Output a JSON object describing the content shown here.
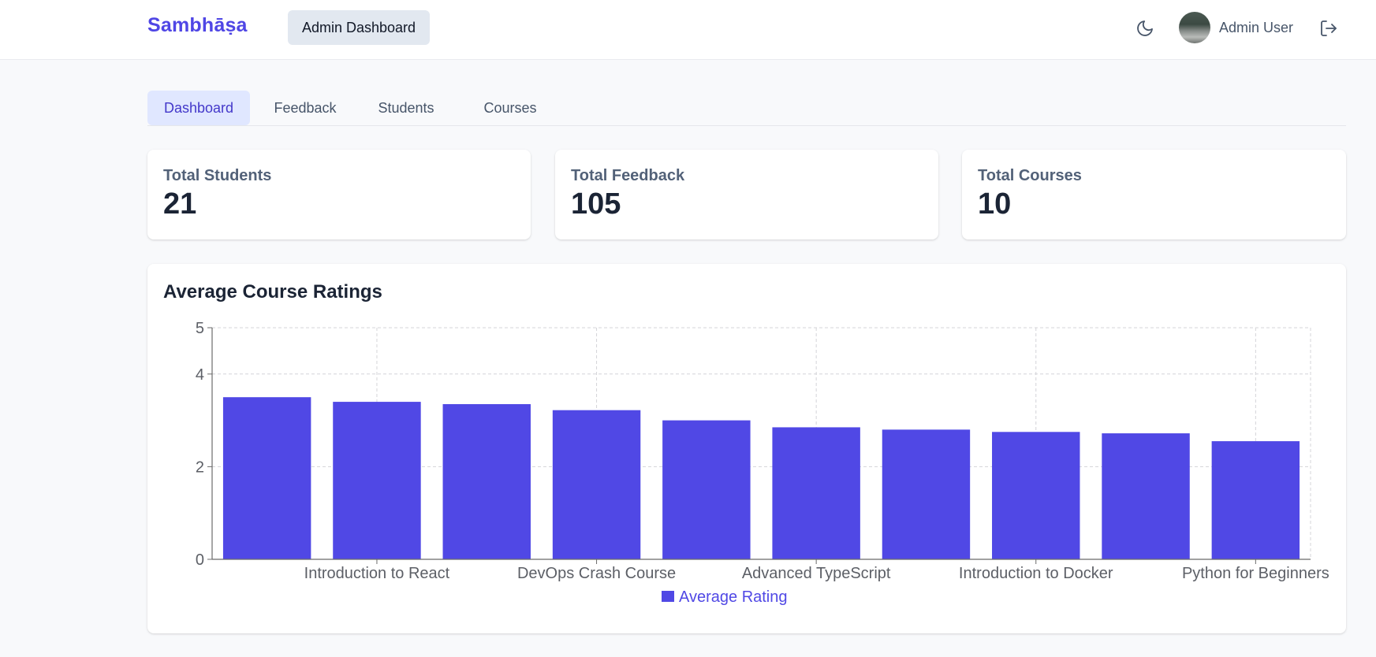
{
  "header": {
    "brand": "Sambhāṣa",
    "role_label": "Admin Dashboard",
    "user_name": "Admin User",
    "theme_icon": "moon-icon",
    "logout_icon": "logout-icon"
  },
  "tabs": [
    {
      "label": "Dashboard",
      "active": true
    },
    {
      "label": "Feedback",
      "active": false
    },
    {
      "label": "Students",
      "active": false
    },
    {
      "label": "Courses",
      "active": false
    }
  ],
  "stats": [
    {
      "label": "Total Students",
      "value": "21"
    },
    {
      "label": "Total Feedback",
      "value": "105"
    },
    {
      "label": "Total Courses",
      "value": "10"
    }
  ],
  "colors": {
    "accent": "#4f46e5",
    "bar": "#5048e5"
  },
  "chart_title": "Average Course Ratings",
  "chart_data": {
    "type": "bar",
    "title": "Average Course Ratings",
    "categories": [
      "",
      "Introduction to React",
      "",
      "DevOps Crash Course",
      "",
      "Advanced TypeScript",
      "",
      "Introduction to Docker",
      "",
      "Python for Beginners"
    ],
    "series": [
      {
        "name": "Average Rating",
        "values": [
          3.5,
          3.4,
          3.35,
          3.22,
          3.0,
          2.85,
          2.8,
          2.75,
          2.72,
          2.55
        ]
      }
    ],
    "y_ticks": [
      0,
      2,
      4,
      5
    ],
    "ylim": [
      0,
      5
    ],
    "xlabel": "",
    "ylabel": "",
    "grid": true,
    "legend_position": "bottom"
  }
}
